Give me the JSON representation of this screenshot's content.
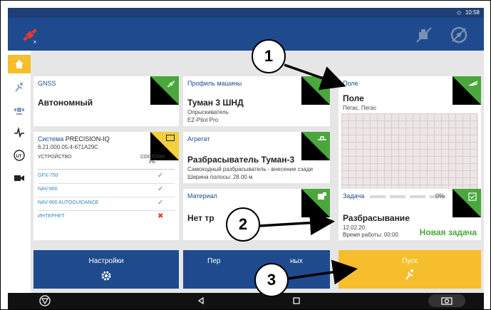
{
  "statusbar": {
    "time": "10:58"
  },
  "colors": {
    "header": "#1f4b8e",
    "green": "#4aa73c",
    "yellow": "#f4d03f",
    "cta": "#f6be2c",
    "map": "#ece6e6"
  },
  "icons": {
    "app": "satellite-icon",
    "appbar_tools": [
      "machine-icon",
      "steering-wheel-icon"
    ],
    "nav": [
      "home-icon",
      "sprayer-icon",
      "gnss-icon",
      "signal-icon",
      "ut-icon",
      "camera-icon"
    ],
    "bottombar": [
      "logo-icon",
      "back-icon",
      "recents-icon",
      "screenshot-icon"
    ]
  },
  "cards": {
    "gnss": {
      "header": "GNSS",
      "value": "Автономный"
    },
    "machine": {
      "header": "Профиль машины",
      "title": "Туман 3 ШНД",
      "line1": "Опрыскиватель",
      "line2": "EZ-Pilot Pro"
    },
    "field": {
      "header": "Поле",
      "title": "Поле",
      "line1": "Пегас, Пегас"
    },
    "system": {
      "header_label": "Система",
      "header_value": "PRECISION-IQ",
      "version": "6.21.000.05.4-671A29C",
      "col_device": "УСТРОЙСТВО",
      "col_status": "СОСТОЯН ИЕ",
      "devices": [
        {
          "name": "GFX-750",
          "status": "✓"
        },
        {
          "name": "NAV-900",
          "status": "✓"
        },
        {
          "name": "NAV-900 AUTOGUIDANCE",
          "status": "✓"
        },
        {
          "name": "ИНТЕРНЕТ",
          "status": "✖"
        }
      ]
    },
    "implement": {
      "header": "Агрегат",
      "title": "Разбрасыватель Туман-3",
      "line1": "Самоходный разбрасыватель - внесение сзади",
      "line2": "Ширина полосы: 28.00 м"
    },
    "material": {
      "header": "Материал",
      "title": "Нет тр"
    },
    "task": {
      "header": "Задача",
      "progress_pct": 0,
      "progress_text": "0%",
      "title": "Разбрасывание",
      "date": "12.02.20",
      "work_time": "Время работы: 00:00",
      "status": "Новая задача"
    }
  },
  "buttons": {
    "settings": "Настройки",
    "middle": "Пер",
    "middle_tail": "ных",
    "start": "Пуск"
  },
  "callouts": [
    "1",
    "2",
    "3"
  ]
}
